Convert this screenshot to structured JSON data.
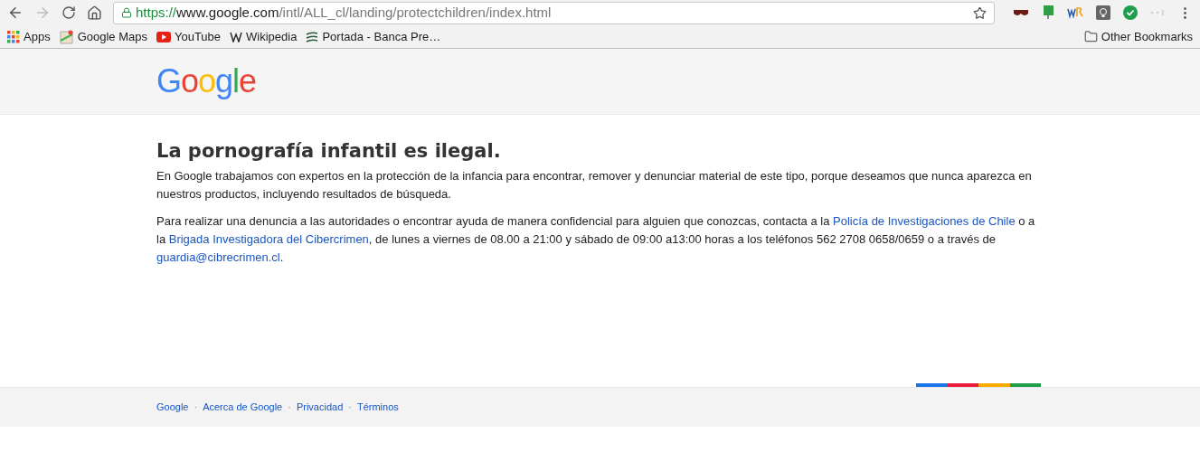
{
  "browser": {
    "url_scheme": "https://",
    "url_host": "www.google.com",
    "url_path": "/intl/ALL_cl/landing/protectchildren/index.html",
    "bookmarks": [
      {
        "label": "Apps",
        "kind": "apps"
      },
      {
        "label": "Google Maps",
        "kind": "maps"
      },
      {
        "label": "YouTube",
        "kind": "youtube"
      },
      {
        "label": "Wikipedia",
        "kind": "wiki"
      },
      {
        "label": "Portada - Banca Pre…",
        "kind": "bank"
      }
    ],
    "other_bookmarks": "Other Bookmarks"
  },
  "header": {
    "logo": "Google"
  },
  "content": {
    "title": "La pornografía infantil es ilegal.",
    "paragraphs": [
      [
        {
          "kind": "text",
          "text": "En Google trabajamos con expertos en la protección de la infancia para encontrar, remover y denunciar material de este tipo, porque deseamos que nunca aparezca en nuestros productos, incluyendo resultados de búsqueda."
        }
      ],
      [
        {
          "kind": "text",
          "text": "Para realizar una denuncia a las autoridades o encontrar ayuda de manera confidencial para alguien que conozcas, contacta a la "
        },
        {
          "kind": "link",
          "text": "Policía de Investigaciones de Chile"
        },
        {
          "kind": "text",
          "text": " o a la "
        },
        {
          "kind": "link",
          "text": "Brigada Investigadora del Cibercrimen"
        },
        {
          "kind": "text",
          "text": ", de lunes a viernes de 08.00 a 21:00 y sábado de 09:00 a13:00 horas a los teléfonos 562 2708 0658/0659 o a través de "
        },
        {
          "kind": "link",
          "text": "guardia@cibrecrimen.cl"
        },
        {
          "kind": "text",
          "text": "."
        }
      ]
    ]
  },
  "footer": {
    "links": [
      "Google",
      "Acerca de Google",
      "Privacidad",
      "Términos"
    ],
    "separator": "·"
  }
}
